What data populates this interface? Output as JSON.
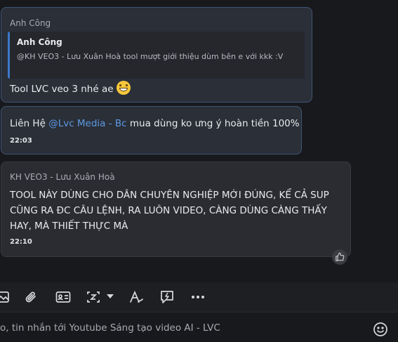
{
  "messages": [
    {
      "sender": "Anh Công",
      "reply": {
        "name": "Anh Công",
        "text": "@KH VEO3 - Lưu Xuân Hoà tool mượt giới thiệu dùm bên e với kkk :V"
      },
      "text": "Tool LVC veo 3 nhé ae",
      "emoji": "grinning-face-icon"
    },
    {
      "prefix": "Liên Hệ",
      "mention": "@Lvc Media - Bc",
      "suffix": "mua dùng ko ưng ý hoàn tiền 100%",
      "time": "22:03"
    },
    {
      "sender": "KH VEO3 - Lưu Xuân Hoà",
      "lines": [
        "TOOL NÀY DÙNG CHO DÂN CHUYÊN NGHIỆP MỚI ĐÚNG, KỂ CẢ SUP",
        "CŨNG RA ĐC CÂU LỆNH, RA LUÔN VIDEO, CÀNG DÙNG CÀNG THẤY",
        "HAY, MÀ THIẾT THỰC MÀ"
      ],
      "time": "22:10"
    }
  ],
  "toolbar": {
    "icons": [
      "image-icon",
      "attachment-icon",
      "contact-card-icon",
      "zalo-sticker-icon",
      "dropdown-icon",
      "text-format-icon",
      "quick-message-icon",
      "more-icon"
    ]
  },
  "composer": {
    "placeholder": "o, tin nhắn tới Youtube Sáng tạo video AI - LVC"
  },
  "colors": {
    "background": "#18191c",
    "outgoing_bubble": "#2a2f38",
    "outgoing_border": "#3e5575",
    "incoming_bubble": "#2b2c31",
    "mention": "#5d99e0",
    "reply_accent": "#3c79c9"
  }
}
